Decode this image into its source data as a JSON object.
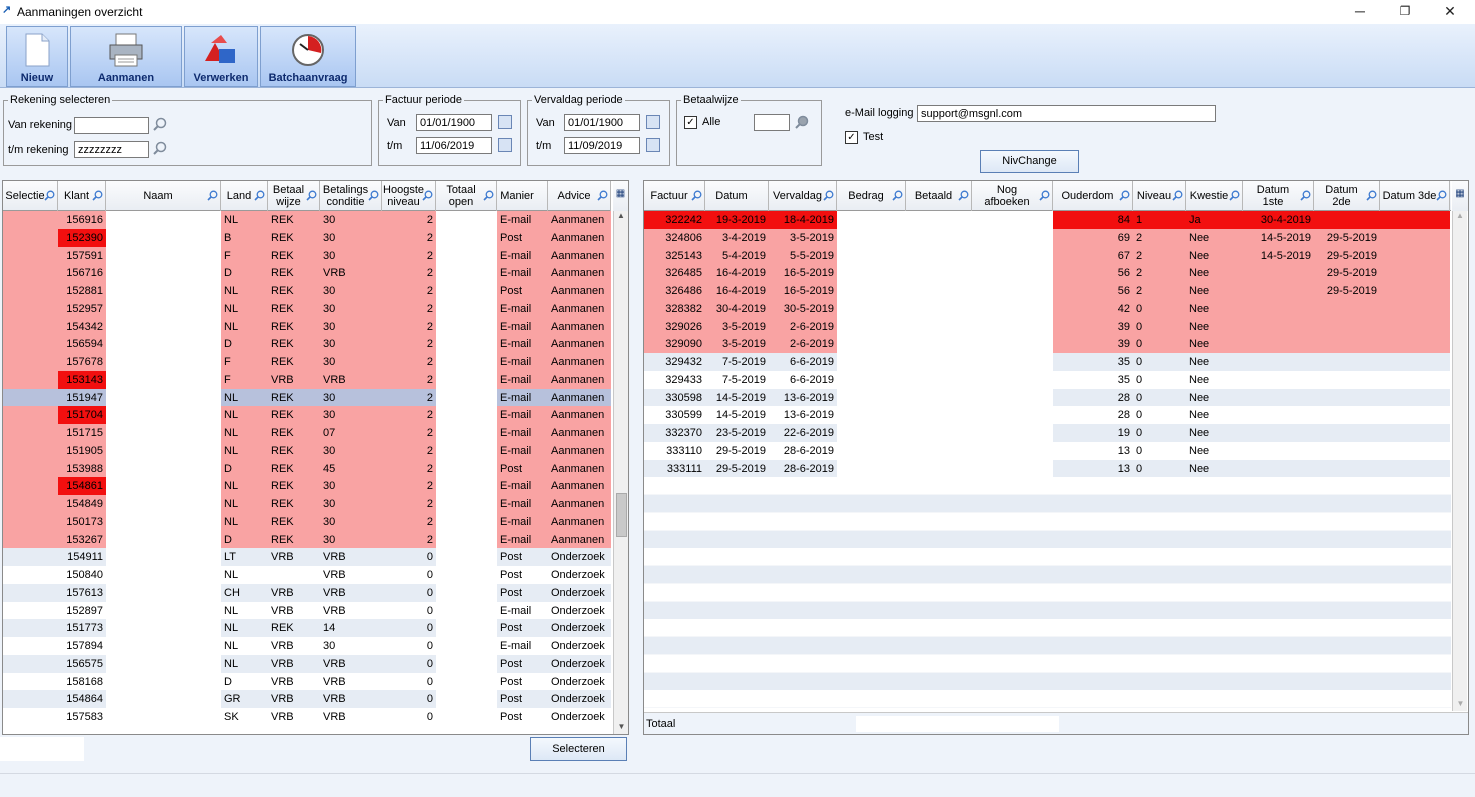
{
  "window": {
    "title": "Aanmaningen overzicht",
    "min": "─",
    "max": "❐",
    "close": "✕"
  },
  "toolbar": [
    {
      "label": "Nieuw",
      "icon": "new-document-icon"
    },
    {
      "label": "Aanmanen",
      "icon": "printer-icon"
    },
    {
      "label": "Verwerken",
      "icon": "process-shapes-icon"
    },
    {
      "label": "Batchaanvraag",
      "icon": "clock-icon"
    }
  ],
  "rekening": {
    "legend": "Rekening selecteren",
    "van_label": "Van rekening",
    "van_value": "",
    "tm_label": "t/m rekening",
    "tm_value": "zzzzzzzz"
  },
  "factuur": {
    "legend": "Factuur periode",
    "van_label": "Van",
    "van_value": "01/01/1900",
    "tm_label": "t/m",
    "tm_value": "11/06/2019"
  },
  "vervaldag": {
    "legend": "Vervaldag periode",
    "van_label": "Van",
    "van_value": "01/01/1900",
    "tm_label": "t/m",
    "tm_value": "11/09/2019"
  },
  "betaalwijze": {
    "legend": "Betaalwijze",
    "alle_label": "Alle",
    "alle_checked": true,
    "value": ""
  },
  "email": {
    "label": "e-Mail logging",
    "value": "support@msgnl.com",
    "test_label": "Test",
    "test_checked": true
  },
  "niv_button": "NivChange",
  "select_button": "Selecteren",
  "left_grid": {
    "columns": [
      {
        "label": "Selectie",
        "search": true
      },
      {
        "label": "Klant",
        "search": true
      },
      {
        "label": "Naam",
        "search": true
      },
      {
        "label": "Land",
        "search": true
      },
      {
        "label": "Betaal wijze",
        "search": true
      },
      {
        "label": "Betalings conditie",
        "search": true
      },
      {
        "label": "Hoogste niveau",
        "search": true
      },
      {
        "label": "Totaal open",
        "search": true
      },
      {
        "label": "Manier",
        "search": false
      },
      {
        "label": "Advice",
        "search": true
      }
    ],
    "rows": [
      {
        "klant": "156916",
        "land": "NL",
        "betaalwijze": "REK",
        "conditie": "30",
        "niveau": "2",
        "manier": "E-mail",
        "advice": "Aanmanen",
        "style": "pink"
      },
      {
        "klant": "152390",
        "land": "B",
        "betaalwijze": "REK",
        "conditie": "30",
        "niveau": "2",
        "manier": "Post",
        "advice": "Aanmanen",
        "style": "pink",
        "klant_red": true
      },
      {
        "klant": "157591",
        "land": "F",
        "betaalwijze": "REK",
        "conditie": "30",
        "niveau": "2",
        "manier": "E-mail",
        "advice": "Aanmanen",
        "style": "pink"
      },
      {
        "klant": "156716",
        "land": "D",
        "betaalwijze": "REK",
        "conditie": "VRB",
        "niveau": "2",
        "manier": "E-mail",
        "advice": "Aanmanen",
        "style": "pink"
      },
      {
        "klant": "152881",
        "land": "NL",
        "betaalwijze": "REK",
        "conditie": "30",
        "niveau": "2",
        "manier": "Post",
        "advice": "Aanmanen",
        "style": "pink"
      },
      {
        "klant": "152957",
        "land": "NL",
        "betaalwijze": "REK",
        "conditie": "30",
        "niveau": "2",
        "manier": "E-mail",
        "advice": "Aanmanen",
        "style": "pink"
      },
      {
        "klant": "154342",
        "land": "NL",
        "betaalwijze": "REK",
        "conditie": "30",
        "niveau": "2",
        "manier": "E-mail",
        "advice": "Aanmanen",
        "style": "pink"
      },
      {
        "klant": "156594",
        "land": "D",
        "betaalwijze": "REK",
        "conditie": "30",
        "niveau": "2",
        "manier": "E-mail",
        "advice": "Aanmanen",
        "style": "pink"
      },
      {
        "klant": "157678",
        "land": "F",
        "betaalwijze": "REK",
        "conditie": "30",
        "niveau": "2",
        "manier": "E-mail",
        "advice": "Aanmanen",
        "style": "pink"
      },
      {
        "klant": "153143",
        "land": "F",
        "betaalwijze": "VRB",
        "conditie": "VRB",
        "niveau": "2",
        "manier": "E-mail",
        "advice": "Aanmanen",
        "style": "pink",
        "klant_red": true
      },
      {
        "klant": "151947",
        "land": "NL",
        "betaalwijze": "REK",
        "conditie": "30",
        "niveau": "2",
        "manier": "E-mail",
        "advice": "Aanmanen",
        "style": "selected"
      },
      {
        "klant": "151704",
        "land": "NL",
        "betaalwijze": "REK",
        "conditie": "30",
        "niveau": "2",
        "manier": "E-mail",
        "advice": "Aanmanen",
        "style": "pink",
        "klant_red": true
      },
      {
        "klant": "151715",
        "land": "NL",
        "betaalwijze": "REK",
        "conditie": "07",
        "niveau": "2",
        "manier": "E-mail",
        "advice": "Aanmanen",
        "style": "pink"
      },
      {
        "klant": "151905",
        "land": "NL",
        "betaalwijze": "REK",
        "conditie": "30",
        "niveau": "2",
        "manier": "E-mail",
        "advice": "Aanmanen",
        "style": "pink"
      },
      {
        "klant": "153988",
        "land": "D",
        "betaalwijze": "REK",
        "conditie": "45",
        "niveau": "2",
        "manier": "Post",
        "advice": "Aanmanen",
        "style": "pink"
      },
      {
        "klant": "154861",
        "land": "NL",
        "betaalwijze": "REK",
        "conditie": "30",
        "niveau": "2",
        "manier": "E-mail",
        "advice": "Aanmanen",
        "style": "pink",
        "klant_red": true
      },
      {
        "klant": "154849",
        "land": "NL",
        "betaalwijze": "REK",
        "conditie": "30",
        "niveau": "2",
        "manier": "E-mail",
        "advice": "Aanmanen",
        "style": "pink"
      },
      {
        "klant": "150173",
        "land": "NL",
        "betaalwijze": "REK",
        "conditie": "30",
        "niveau": "2",
        "manier": "E-mail",
        "advice": "Aanmanen",
        "style": "pink"
      },
      {
        "klant": "153267",
        "land": "D",
        "betaalwijze": "REK",
        "conditie": "30",
        "niveau": "2",
        "manier": "E-mail",
        "advice": "Aanmanen",
        "style": "pink"
      },
      {
        "klant": "154911",
        "land": "LT",
        "betaalwijze": "VRB",
        "conditie": "VRB",
        "niveau": "0",
        "manier": "Post",
        "advice": "Onderzoek",
        "style": "alt"
      },
      {
        "klant": "150840",
        "land": "NL",
        "betaalwijze": "",
        "conditie": "VRB",
        "niveau": "0",
        "manier": "Post",
        "advice": "Onderzoek",
        "style": "white"
      },
      {
        "klant": "157613",
        "land": "CH",
        "betaalwijze": "VRB",
        "conditie": "VRB",
        "niveau": "0",
        "manier": "Post",
        "advice": "Onderzoek",
        "style": "alt"
      },
      {
        "klant": "152897",
        "land": "NL",
        "betaalwijze": "VRB",
        "conditie": "VRB",
        "niveau": "0",
        "manier": "E-mail",
        "advice": "Onderzoek",
        "style": "white"
      },
      {
        "klant": "151773",
        "land": "NL",
        "betaalwijze": "REK",
        "conditie": "14",
        "niveau": "0",
        "manier": "Post",
        "advice": "Onderzoek",
        "style": "alt"
      },
      {
        "klant": "157894",
        "land": "NL",
        "betaalwijze": "VRB",
        "conditie": "30",
        "niveau": "0",
        "manier": "E-mail",
        "advice": "Onderzoek",
        "style": "white"
      },
      {
        "klant": "156575",
        "land": "NL",
        "betaalwijze": "VRB",
        "conditie": "VRB",
        "niveau": "0",
        "manier": "Post",
        "advice": "Onderzoek",
        "style": "alt"
      },
      {
        "klant": "158168",
        "land": "D",
        "betaalwijze": "VRB",
        "conditie": "VRB",
        "niveau": "0",
        "manier": "Post",
        "advice": "Onderzoek",
        "style": "white"
      },
      {
        "klant": "154864",
        "land": "GR",
        "betaalwijze": "VRB",
        "conditie": "VRB",
        "niveau": "0",
        "manier": "Post",
        "advice": "Onderzoek",
        "style": "alt"
      },
      {
        "klant": "157583",
        "land": "SK",
        "betaalwijze": "VRB",
        "conditie": "VRB",
        "niveau": "0",
        "manier": "Post",
        "advice": "Onderzoek",
        "style": "white"
      }
    ]
  },
  "right_grid": {
    "columns": [
      {
        "label": "Factuur",
        "search": true
      },
      {
        "label": "Datum",
        "search": false
      },
      {
        "label": "Vervaldag",
        "search": true
      },
      {
        "label": "Bedrag",
        "search": true
      },
      {
        "label": "Betaald",
        "search": true
      },
      {
        "label": "Nog afboeken",
        "search": true
      },
      {
        "label": "Ouderdom",
        "search": true
      },
      {
        "label": "Niveau",
        "search": true
      },
      {
        "label": "Kwestie",
        "search": true
      },
      {
        "label": "Datum 1ste",
        "search": true
      },
      {
        "label": "Datum 2de",
        "search": true
      },
      {
        "label": "Datum 3de",
        "search": true
      }
    ],
    "rows": [
      {
        "factuur": "322242",
        "datum": "19-3-2019",
        "vervaldag": "18-4-2019",
        "ouderdom": "84",
        "niveau": "1",
        "kwestie": "Ja",
        "d1": "30-4-2019",
        "d2": "",
        "d3": "",
        "style": "red"
      },
      {
        "factuur": "324806",
        "datum": "3-4-2019",
        "vervaldag": "3-5-2019",
        "ouderdom": "69",
        "niveau": "2",
        "kwestie": "Nee",
        "d1": "14-5-2019",
        "d2": "29-5-2019",
        "d3": "",
        "style": "pink"
      },
      {
        "factuur": "325143",
        "datum": "5-4-2019",
        "vervaldag": "5-5-2019",
        "ouderdom": "67",
        "niveau": "2",
        "kwestie": "Nee",
        "d1": "14-5-2019",
        "d2": "29-5-2019",
        "d3": "",
        "style": "pink"
      },
      {
        "factuur": "326485",
        "datum": "16-4-2019",
        "vervaldag": "16-5-2019",
        "ouderdom": "56",
        "niveau": "2",
        "kwestie": "Nee",
        "d1": "",
        "d2": "29-5-2019",
        "d3": "",
        "style": "pink"
      },
      {
        "factuur": "326486",
        "datum": "16-4-2019",
        "vervaldag": "16-5-2019",
        "ouderdom": "56",
        "niveau": "2",
        "kwestie": "Nee",
        "d1": "",
        "d2": "29-5-2019",
        "d3": "",
        "style": "pink"
      },
      {
        "factuur": "328382",
        "datum": "30-4-2019",
        "vervaldag": "30-5-2019",
        "ouderdom": "42",
        "niveau": "0",
        "kwestie": "Nee",
        "d1": "",
        "d2": "",
        "d3": "",
        "style": "pink"
      },
      {
        "factuur": "329026",
        "datum": "3-5-2019",
        "vervaldag": "2-6-2019",
        "ouderdom": "39",
        "niveau": "0",
        "kwestie": "Nee",
        "d1": "",
        "d2": "",
        "d3": "",
        "style": "pink"
      },
      {
        "factuur": "329090",
        "datum": "3-5-2019",
        "vervaldag": "2-6-2019",
        "ouderdom": "39",
        "niveau": "0",
        "kwestie": "Nee",
        "d1": "",
        "d2": "",
        "d3": "",
        "style": "pink"
      },
      {
        "factuur": "329432",
        "datum": "7-5-2019",
        "vervaldag": "6-6-2019",
        "ouderdom": "35",
        "niveau": "0",
        "kwestie": "Nee",
        "d1": "",
        "d2": "",
        "d3": "",
        "style": "alt"
      },
      {
        "factuur": "329433",
        "datum": "7-5-2019",
        "vervaldag": "6-6-2019",
        "ouderdom": "35",
        "niveau": "0",
        "kwestie": "Nee",
        "d1": "",
        "d2": "",
        "d3": "",
        "style": "white"
      },
      {
        "factuur": "330598",
        "datum": "14-5-2019",
        "vervaldag": "13-6-2019",
        "ouderdom": "28",
        "niveau": "0",
        "kwestie": "Nee",
        "d1": "",
        "d2": "",
        "d3": "",
        "style": "alt"
      },
      {
        "factuur": "330599",
        "datum": "14-5-2019",
        "vervaldag": "13-6-2019",
        "ouderdom": "28",
        "niveau": "0",
        "kwestie": "Nee",
        "d1": "",
        "d2": "",
        "d3": "",
        "style": "white"
      },
      {
        "factuur": "332370",
        "datum": "23-5-2019",
        "vervaldag": "22-6-2019",
        "ouderdom": "19",
        "niveau": "0",
        "kwestie": "Nee",
        "d1": "",
        "d2": "",
        "d3": "",
        "style": "alt"
      },
      {
        "factuur": "333110",
        "datum": "29-5-2019",
        "vervaldag": "28-6-2019",
        "ouderdom": "13",
        "niveau": "0",
        "kwestie": "Nee",
        "d1": "",
        "d2": "",
        "d3": "",
        "style": "white"
      },
      {
        "factuur": "333111",
        "datum": "29-5-2019",
        "vervaldag": "28-6-2019",
        "ouderdom": "13",
        "niveau": "0",
        "kwestie": "Nee",
        "d1": "",
        "d2": "",
        "d3": "",
        "style": "alt"
      }
    ],
    "totaal_label": "Totaal",
    "totaal_value": ""
  },
  "colors": {
    "pink": "#f9a3a3",
    "red": "#f20f0f",
    "selected": "#b7c1dc",
    "alt": "#e6ecf4",
    "white": "#ffffff"
  }
}
